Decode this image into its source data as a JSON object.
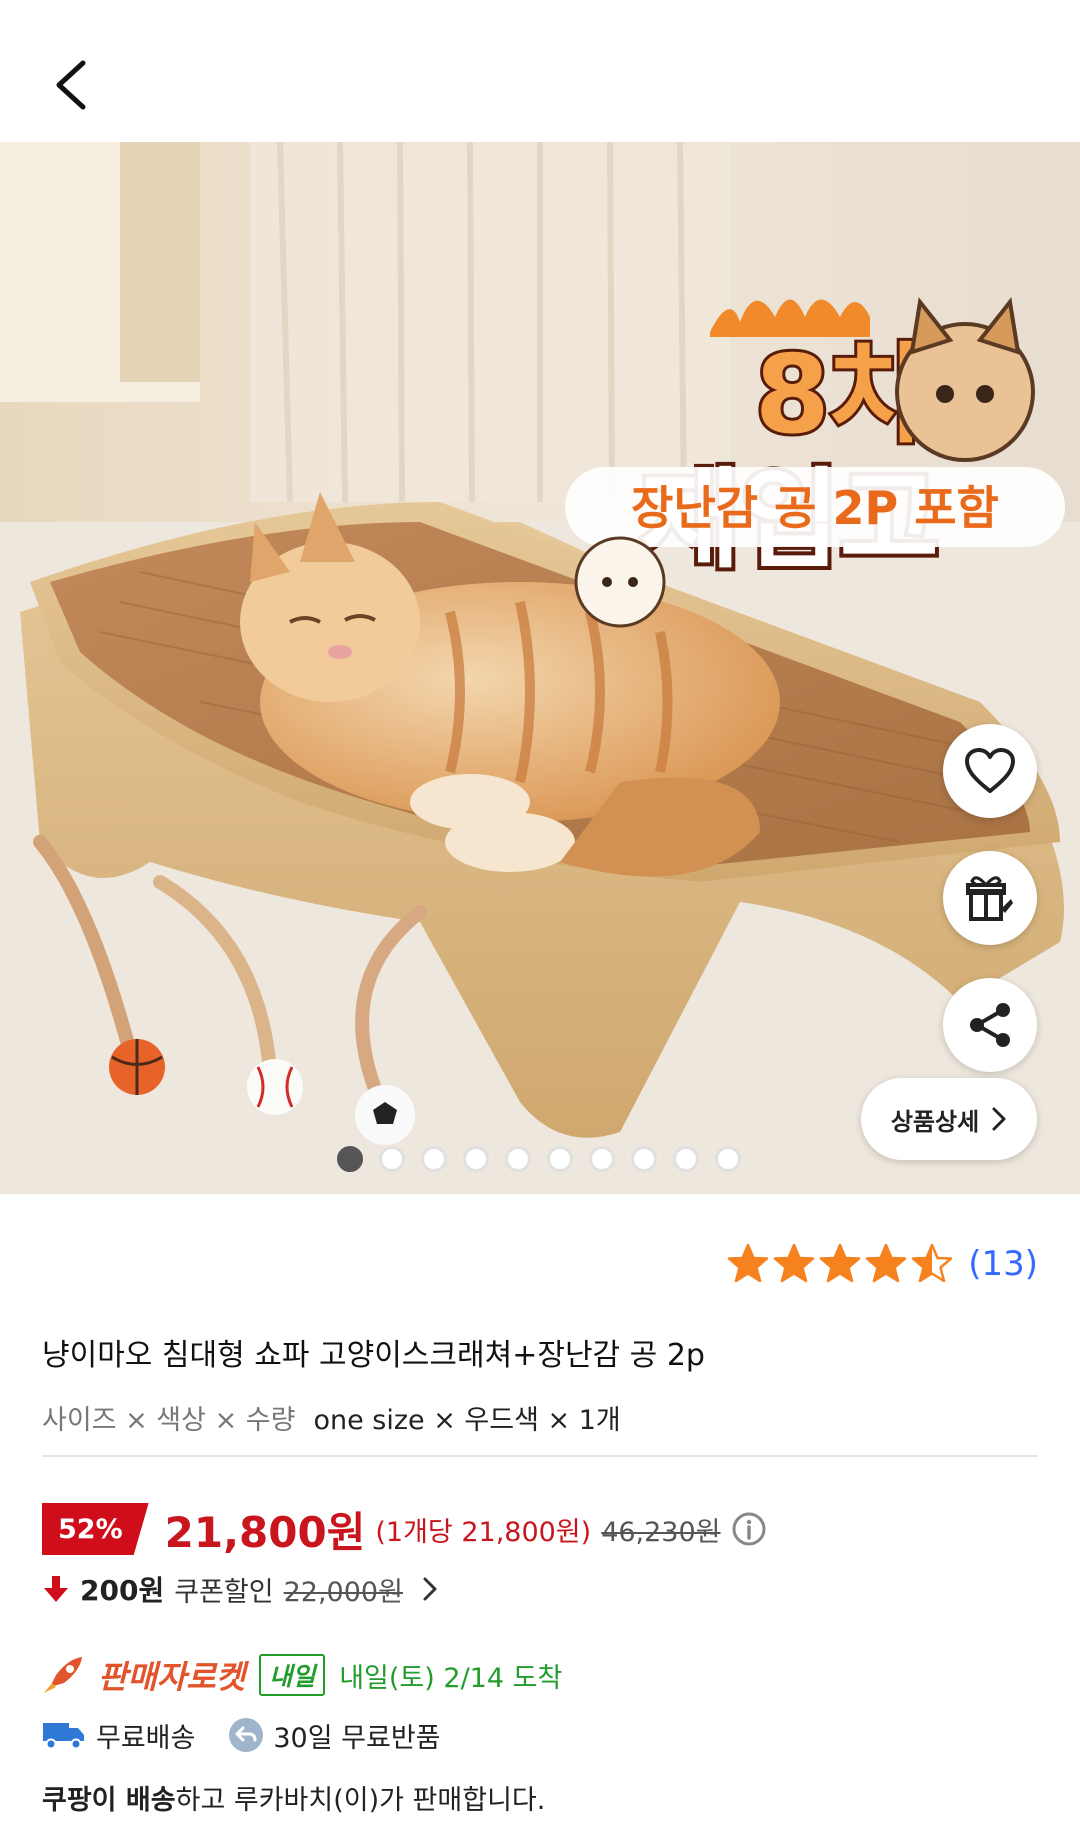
{
  "header": {
    "back_icon": "chevron-left-icon"
  },
  "hero": {
    "overlay_line1": "8차",
    "overlay_line2": "재입고",
    "overlay_banner": "장난감 공 2P 포함",
    "detail_button_label": "상품상세",
    "dot_count": 10,
    "active_dot": 1,
    "actions": [
      "heart-icon",
      "gift-icon",
      "share-icon"
    ]
  },
  "rating": {
    "stars": 4.5,
    "count": "(13)"
  },
  "product": {
    "title": "냥이마오 침대형 쇼파 고양이스크래쳐+장난감 공 2p",
    "option_label": "사이즈 × 색상 × 수량",
    "option_value": "one size × 우드색 × 1개"
  },
  "price": {
    "discount": "52%",
    "sale_price": "21,800원",
    "unit_price": "(1개당 21,800원)",
    "original_price": "46,230원"
  },
  "coupon": {
    "amount": "200원",
    "label": "쿠폰할인",
    "original": "22,000원"
  },
  "delivery": {
    "rocket_label": "판매자로켓",
    "tomorrow_badge": "내일",
    "arrival": "내일(토) 2/14 도착",
    "free_shipping": "무료배송",
    "free_return": "30일 무료반품"
  },
  "seller": {
    "prefix_bold": "쿠팡이 배송",
    "text": "하고 루카바치(이)가 판매합니다."
  },
  "colors": {
    "accent_red": "#c9161e",
    "badge_red": "#d00d1b",
    "green": "#229d2c",
    "link_blue": "#346aff",
    "rocket_orange": "#e2542b"
  }
}
